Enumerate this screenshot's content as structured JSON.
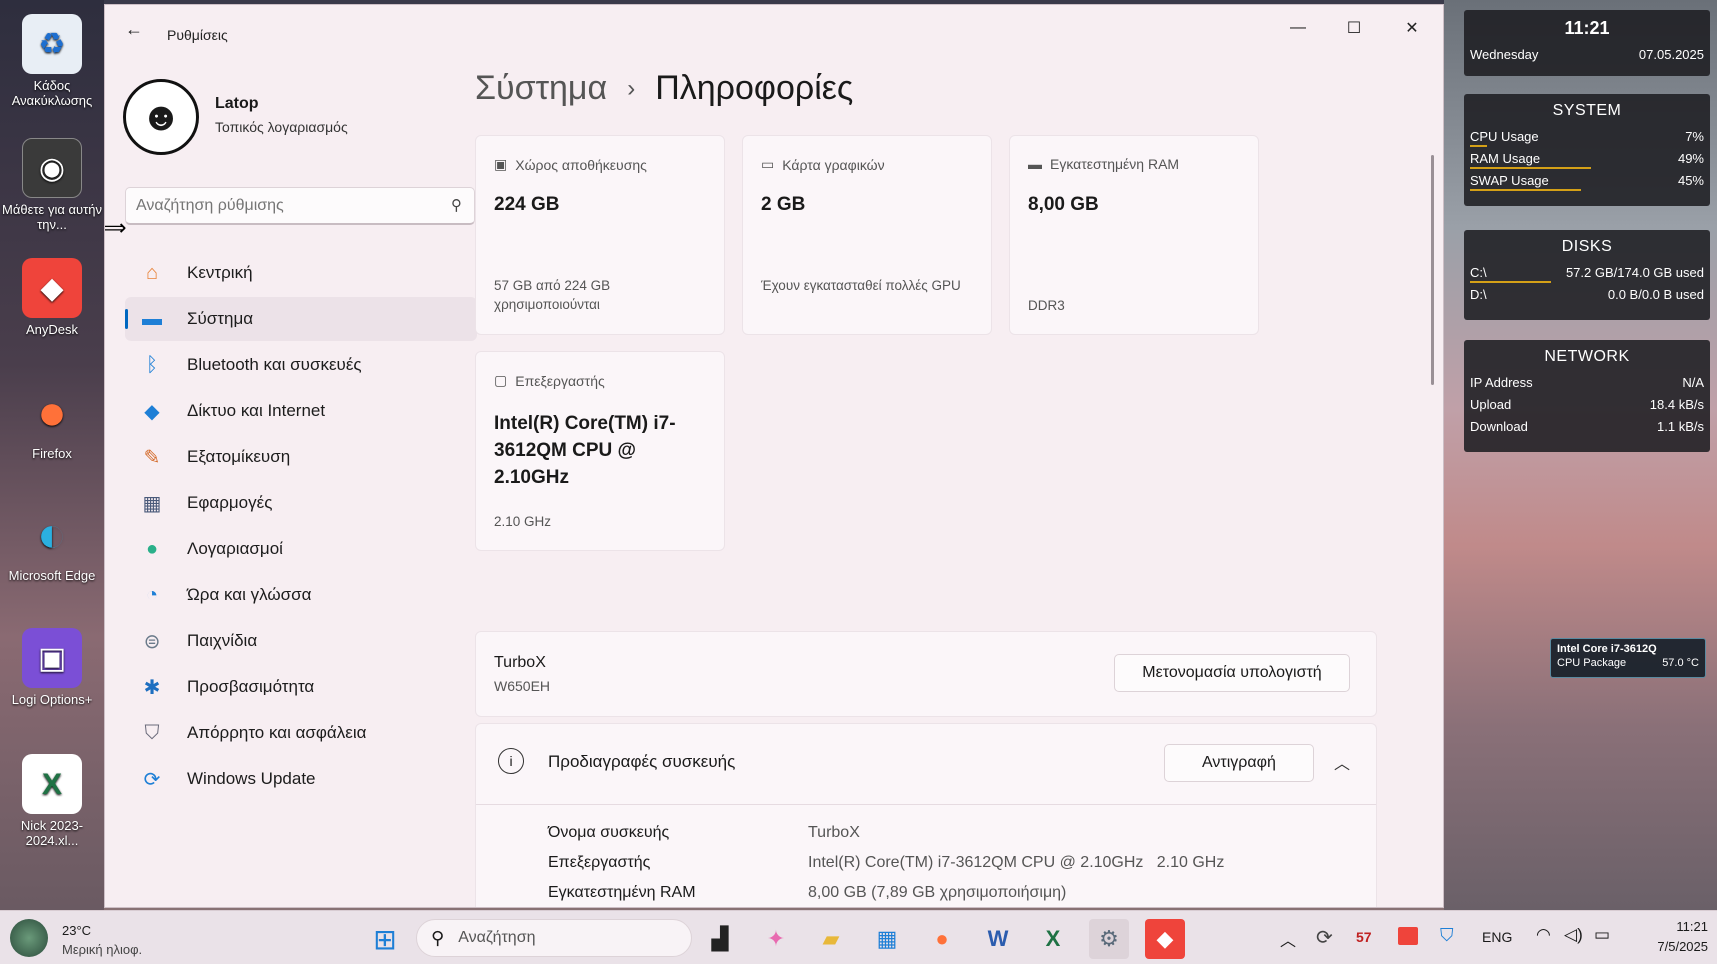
{
  "desktop": {
    "icons": [
      {
        "label": "Κάδος Ανακύκλωσης",
        "icon": "recycle-bin-icon",
        "glyph": "♻",
        "bg": "#e8eef5",
        "fg": "#1e6fd0"
      },
      {
        "label": "Μάθετε για αυτήν την...",
        "icon": "learn-about-picture-icon",
        "glyph": "◉",
        "bg": "#3a3a3a",
        "fg": "#ffffff"
      },
      {
        "label": "AnyDesk",
        "icon": "anydesk-icon",
        "glyph": "◆",
        "bg": "#ef443b",
        "fg": "#ffffff"
      },
      {
        "label": "Firefox",
        "icon": "firefox-icon",
        "glyph": "●",
        "bg": "transparent",
        "fg": "#ff7139"
      },
      {
        "label": "Microsoft Edge",
        "icon": "edge-icon",
        "glyph": "◐",
        "bg": "transparent",
        "fg": "#2bb0e0"
      },
      {
        "label": "Logi Options+",
        "icon": "logi-options-icon",
        "glyph": "▣",
        "bg": "#7b4fd6",
        "fg": "#ffffff"
      },
      {
        "label": "Nick 2023-2024.xl...",
        "icon": "excel-file-icon",
        "glyph": "X",
        "bg": "#ffffff",
        "fg": "#1f7244"
      }
    ]
  },
  "widgets": {
    "clock": {
      "time": "11:21",
      "day": "Wednesday",
      "date": "07.05.2025"
    },
    "system": {
      "title": "SYSTEM",
      "rows": [
        {
          "label": "CPU Usage",
          "value": "7%",
          "percent": 7
        },
        {
          "label": "RAM Usage",
          "value": "49%",
          "percent": 49
        },
        {
          "label": "SWAP Usage",
          "value": "45%",
          "percent": 45
        }
      ]
    },
    "disks": {
      "title": "DISKS",
      "rows": [
        {
          "label": "C:\\",
          "value": "57.2 GB/174.0 GB used",
          "percent": 33
        },
        {
          "label": "D:\\",
          "value": "0.0 B/0.0 B used",
          "percent": 0
        }
      ]
    },
    "network": {
      "title": "NETWORK",
      "rows": [
        {
          "label": "IP Address",
          "value": "N/A"
        },
        {
          "label": "Upload",
          "value": "18.4 kB/s"
        },
        {
          "label": "Download",
          "value": "1.1 kB/s"
        }
      ]
    },
    "cpu_temp": {
      "name": "Intel Core i7-3612Q",
      "label": "CPU Package",
      "value": "57.0 °C"
    }
  },
  "window": {
    "title": "Ρυθμίσεις",
    "back": "←",
    "minimize": "—",
    "maximize": "☐",
    "close": "✕"
  },
  "profile": {
    "name": "Latop",
    "account": "Τοπικός λογαριασμός"
  },
  "search": {
    "placeholder": "Αναζήτηση ρύθμισης"
  },
  "nav": [
    {
      "label": "Κεντρική",
      "icon": "home-icon",
      "glyph": "⌂",
      "color": "#e8833a"
    },
    {
      "label": "Σύστημα",
      "icon": "system-icon",
      "glyph": "▬",
      "color": "#1e7fd6",
      "active": true
    },
    {
      "label": "Bluetooth και συσκευές",
      "icon": "bluetooth-icon",
      "glyph": "ᛒ",
      "color": "#1e7fd6"
    },
    {
      "label": "Δίκτυο και Internet",
      "icon": "network-icon",
      "glyph": "◆",
      "color": "#1e7fd6"
    },
    {
      "label": "Εξατομίκευση",
      "icon": "personalization-icon",
      "glyph": "✎",
      "color": "#d46a2a"
    },
    {
      "label": "Εφαρμογές",
      "icon": "apps-icon",
      "glyph": "▦",
      "color": "#4a5a7a"
    },
    {
      "label": "Λογαριασμοί",
      "icon": "accounts-icon",
      "glyph": "●",
      "color": "#2ab08a"
    },
    {
      "label": "Ώρα και γλώσσα",
      "icon": "time-language-icon",
      "glyph": "◔",
      "color": "#1e7fd6"
    },
    {
      "label": "Παιχνίδια",
      "icon": "gaming-icon",
      "glyph": "⊜",
      "color": "#6a7a8a"
    },
    {
      "label": "Προσβασιμότητα",
      "icon": "accessibility-icon",
      "glyph": "✱",
      "color": "#1e6fc0"
    },
    {
      "label": "Απόρρητο και ασφάλεια",
      "icon": "privacy-shield-icon",
      "glyph": "⛉",
      "color": "#6a6a7a"
    },
    {
      "label": "Windows Update",
      "icon": "windows-update-icon",
      "glyph": "⟳",
      "color": "#1e7fd6"
    }
  ],
  "breadcrumb": {
    "parent": "Σύστημα",
    "separator": "›",
    "current": "Πληροφορίες"
  },
  "cards": {
    "storage": {
      "label": "Χώρος αποθήκευσης",
      "value": "224 GB",
      "sub": "57 GB από 224 GB χρησιμοποιούνται"
    },
    "gpu": {
      "label": "Κάρτα γραφικών",
      "value": "2 GB",
      "sub": "Έχουν εγκατασταθεί πολλές GPU"
    },
    "ram": {
      "label": "Εγκατεστημένη RAM",
      "value": "8,00 GB",
      "sub": "DDR3"
    },
    "cpu": {
      "label": "Επεξεργαστής",
      "value": "Intel(R) Core(TM) i7-3612QM CPU @ 2.10GHz",
      "sub": "2.10 GHz"
    }
  },
  "device": {
    "name": "TurboX",
    "model": "W650EH",
    "rename_button": "Μετονομασία υπολογιστή"
  },
  "specs": {
    "title": "Προδιαγραφές συσκευής",
    "copy_button": "Αντιγραφή",
    "rows": [
      {
        "label": "Όνομα συσκευής",
        "value": "TurboX"
      },
      {
        "label": "Επεξεργαστής",
        "value": "Intel(R) Core(TM) i7-3612QM CPU @ 2.10GHz   2.10 GHz"
      },
      {
        "label": "Εγκατεστημένη RAM",
        "value": "8,00 GB (7,89 GB χρησιμοποιήσιμη)"
      }
    ]
  },
  "taskbar": {
    "weather_temp": "23°C",
    "weather_desc": "Μερική ηλιοφ.",
    "search_placeholder": "Αναζήτηση",
    "tray_badge": "57",
    "language": "ENG",
    "time": "11:21",
    "date": "7/5/2025"
  }
}
